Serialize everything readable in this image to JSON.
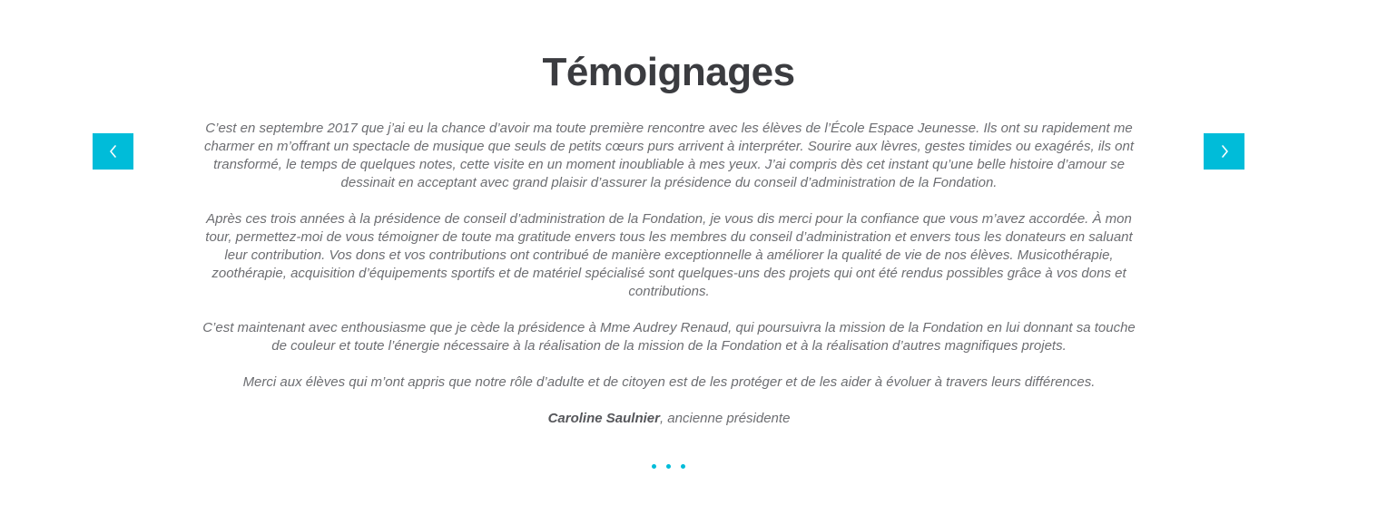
{
  "section": {
    "title": "Témoignages"
  },
  "testimonial": {
    "paragraphs": [
      "C’est en septembre 2017 que j’ai eu la chance d’avoir ma toute première rencontre avec les élèves de l’École Espace Jeunesse.  Ils ont su rapidement me charmer en m’offrant un spectacle de musique que seuls de petits cœurs purs arrivent à interpréter. Sourire aux lèvres, gestes timides ou exagérés, ils ont transformé, le temps de quelques notes, cette visite en un moment inoubliable à mes yeux. J’ai compris dès cet instant qu’une belle histoire d’amour se dessinait en acceptant avec grand plaisir d’assurer la présidence du conseil d’administration de la Fondation.",
      "Après ces trois années à la présidence de conseil d’administration de la Fondation, je vous dis merci pour la confiance que vous m’avez accordée. À mon tour, permettez-moi de vous témoigner de toute ma gratitude envers tous les membres du conseil d’administration et envers tous les donateurs en saluant leur contribution. Vos dons et vos contributions ont contribué de manière exceptionnelle à améliorer la qualité de vie de nos élèves. Musicothérapie, zoothérapie, acquisition d’équipements sportifs et de matériel spécialisé sont quelques-uns des projets qui ont été rendus possibles grâce à vos dons et contributions.",
      "C’est maintenant avec enthousiasme que je cède la présidence à Mme Audrey Renaud, qui poursuivra la mission de la Fondation en lui donnant sa touche de couleur et toute l’énergie nécessaire à la réalisation de la mission de la Fondation et à la réalisation d’autres magnifiques projets.",
      "Merci aux élèves qui m’ont appris que notre rôle d’adulte et de citoyen est de les protéger et de les aider à évoluer à travers leurs différences."
    ],
    "author_name": "Caroline Saulnier",
    "author_role": ", ancienne présidente"
  },
  "carousel": {
    "prev_icon": "chevron-left-icon",
    "next_icon": "chevron-right-icon",
    "dot_count": 3,
    "accent_color": "#00bcd9"
  },
  "colors": {
    "title": "#3b3c40",
    "body_text": "#6d6e72",
    "accent": "#00bcd9"
  }
}
